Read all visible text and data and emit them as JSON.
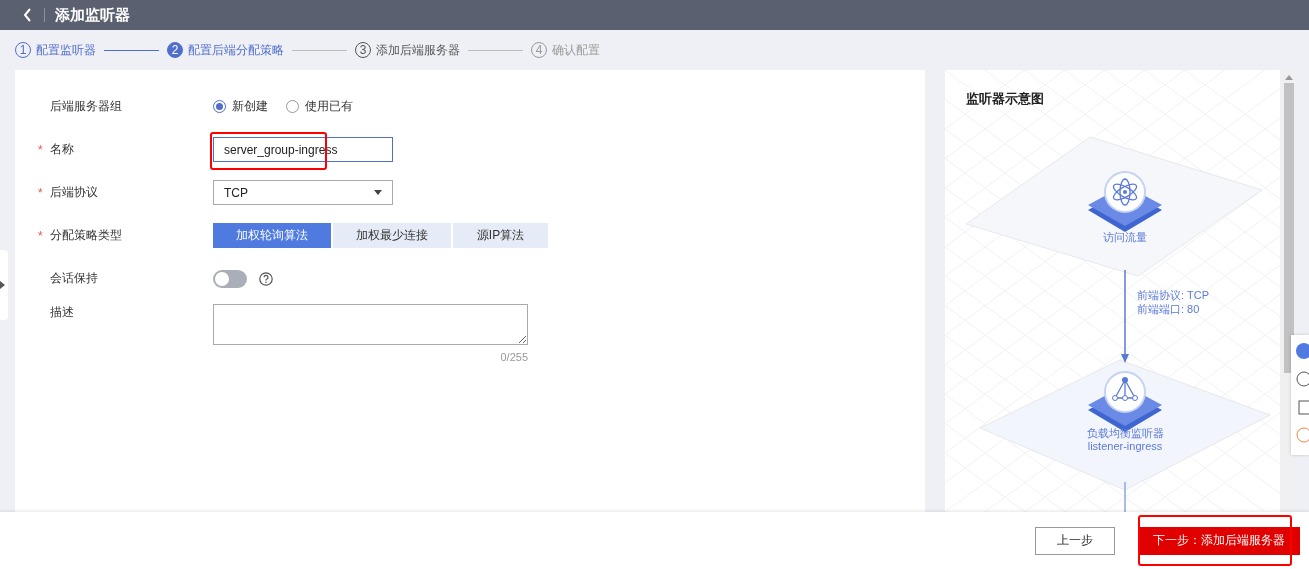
{
  "header": {
    "title": "添加监听器"
  },
  "steps": [
    {
      "number": "1",
      "label": "配置监听器",
      "kind": "done"
    },
    {
      "number": "2",
      "label": "配置后端分配策略",
      "kind": "current"
    },
    {
      "number": "3",
      "label": "添加后端服务器",
      "kind": "next"
    },
    {
      "number": "4",
      "label": "确认配置",
      "kind": "todo"
    }
  ],
  "form": {
    "fields": [
      {
        "kind": "radio",
        "label": "后端服务器组",
        "options": [
          {
            "label": "新创建",
            "selected": true
          },
          {
            "label": "使用已有",
            "selected": false
          }
        ]
      },
      {
        "kind": "text",
        "label": "名称",
        "required_mark": "*",
        "value": "server_group-ingress",
        "highlighted": true
      },
      {
        "kind": "select",
        "label": "后端协议",
        "required_mark": "*",
        "value": "TCP"
      },
      {
        "kind": "segmented",
        "label": "分配策略类型",
        "required_mark": "*",
        "options": [
          {
            "label": "加权轮询算法",
            "selected": true
          },
          {
            "label": "加权最少连接",
            "selected": false
          },
          {
            "label": "源IP算法",
            "selected": false
          }
        ]
      },
      {
        "kind": "switch",
        "label": "会话保持",
        "on": false
      },
      {
        "kind": "textarea",
        "label": "描述",
        "counter": "0/255"
      }
    ]
  },
  "diagram": {
    "title": "监听器示意图",
    "source": {
      "label": "访问流量"
    },
    "link_lines": [
      "前端协议: TCP",
      "前端端口: 80"
    ],
    "listener": {
      "label": "负载均衡监听器",
      "name": "listener-ingress"
    }
  },
  "footer": {
    "buttons": [
      {
        "label": "上一步",
        "kind": "secondary",
        "highlighted": false
      },
      {
        "label": "下一步：添加后端服务器",
        "kind": "primary",
        "highlighted": true
      }
    ]
  }
}
